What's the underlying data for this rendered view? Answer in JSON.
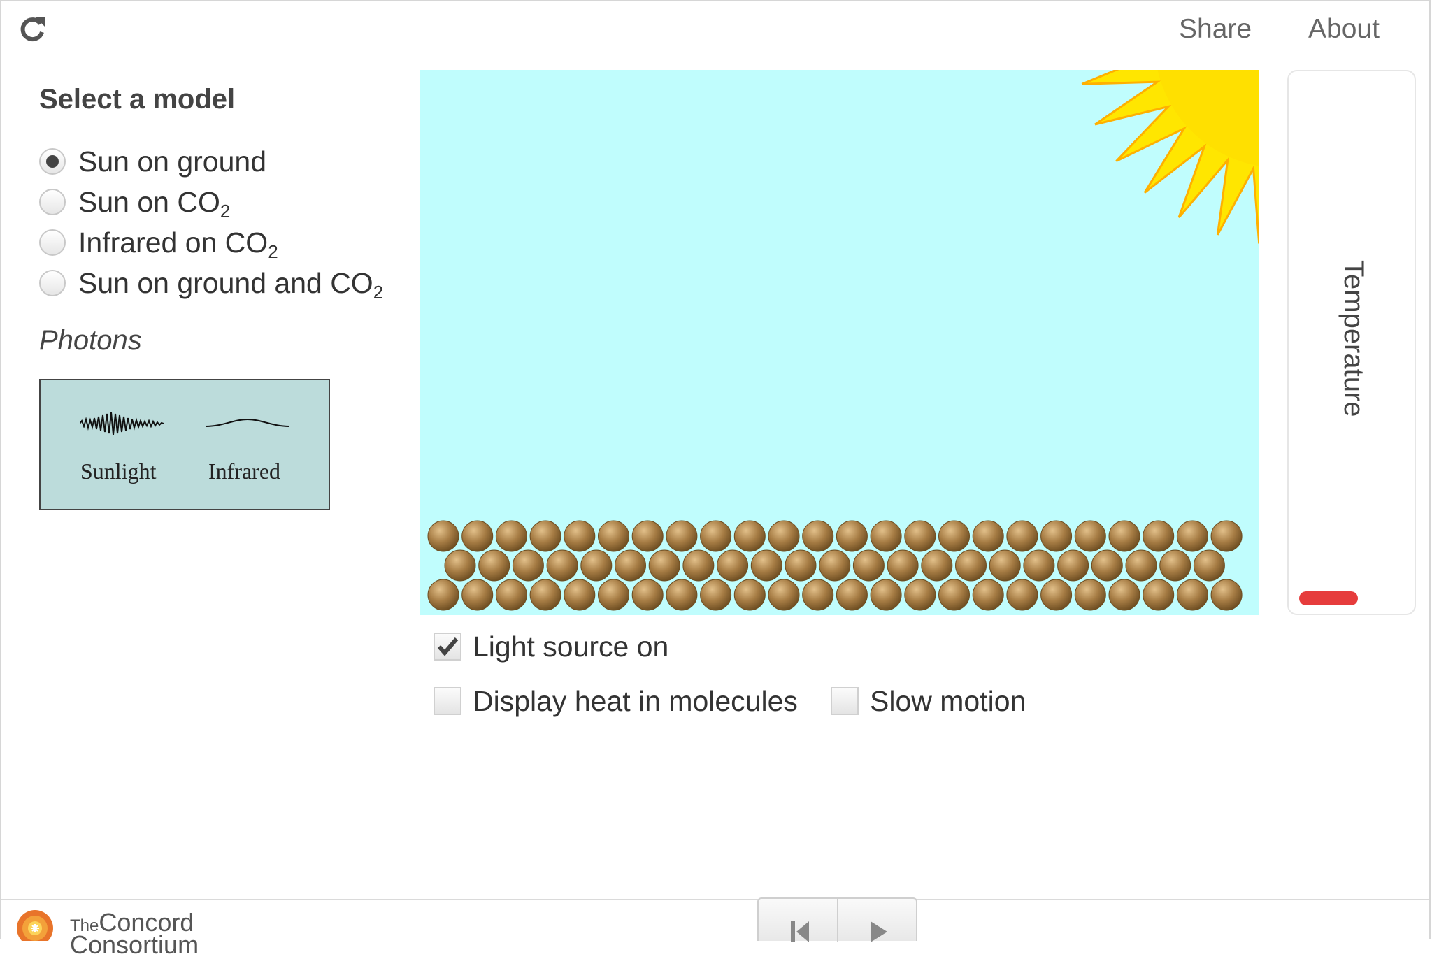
{
  "topbar": {
    "share_label": "Share",
    "about_label": "About"
  },
  "model_select": {
    "heading": "Select a model",
    "options": [
      {
        "text": "Sun on ground",
        "sub": "",
        "checked": true
      },
      {
        "text": "Sun on CO",
        "sub": "2",
        "checked": false
      },
      {
        "text": "Infrared on CO",
        "sub": "2",
        "checked": false
      },
      {
        "text": "Sun on ground and CO",
        "sub": "2",
        "checked": false
      }
    ]
  },
  "photons": {
    "heading": "Photons",
    "sunlight_label": "Sunlight",
    "infrared_label": "Infrared"
  },
  "simulation": {
    "sky_color": "#c0fdfd",
    "sun_color": "#ffe600",
    "ground_molecule_color": "#a67c44",
    "ground_rows": 3
  },
  "controls": {
    "light_source_label": "Light source on",
    "light_source_checked": true,
    "display_heat_label": "Display heat in molecules",
    "display_heat_checked": false,
    "slow_motion_label": "Slow motion",
    "slow_motion_checked": false
  },
  "thermometer": {
    "label": "Temperature",
    "level_color": "#e63c3c"
  },
  "footer": {
    "brand_the": "The",
    "brand_name": "Concord",
    "brand_line2": "Consortium"
  }
}
